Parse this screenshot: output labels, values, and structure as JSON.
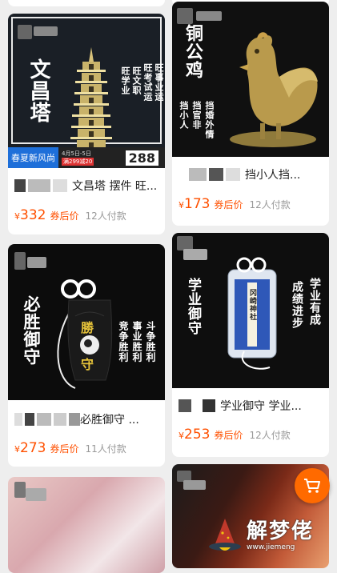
{
  "products": [
    {
      "title": "文昌塔 摆件 旺...",
      "currency": "¥",
      "price": "332",
      "price_tag": "券后价",
      "paid": "12人付款",
      "image": {
        "headline": "文昌塔",
        "lines": [
          "旺学业",
          "旺文职",
          "旺考试运",
          "旺事业运"
        ],
        "banner_text": "春夏新风尚",
        "banner_date": "4月5日-5日",
        "banner_promo": "满299减20",
        "banner_price": "288"
      }
    },
    {
      "title": "挡小人挡...",
      "currency": "¥",
      "price": "173",
      "price_tag": "券后价",
      "paid": "12人付款",
      "image": {
        "headline": "铜公鸡",
        "lines": [
          "挡小人",
          "挡官非",
          "挡婚外情"
        ]
      }
    },
    {
      "title": "必胜御守 ...",
      "currency": "¥",
      "price": "273",
      "price_tag": "券后价",
      "paid": "11人付款",
      "image": {
        "headline": "必胜御守",
        "lines": [
          "竞争胜利",
          "事业胜利",
          "斗争胜利"
        ],
        "charm_text": "勝守"
      }
    },
    {
      "title": "学业御守 学业...",
      "currency": "¥",
      "price": "253",
      "price_tag": "券后价",
      "paid": "12人付款",
      "image": {
        "headline": "学业御守",
        "lines": [
          "成绩进步",
          "学业有成"
        ],
        "charm_text": "冈崎神社"
      }
    }
  ],
  "cart_icon": "shopping-cart-icon",
  "watermark": {
    "text": "解梦佬",
    "url": "www.jiemeng"
  },
  "colors": {
    "accent": "#ff5000",
    "fab": "#ff6a00",
    "background": "#eeeeee"
  }
}
